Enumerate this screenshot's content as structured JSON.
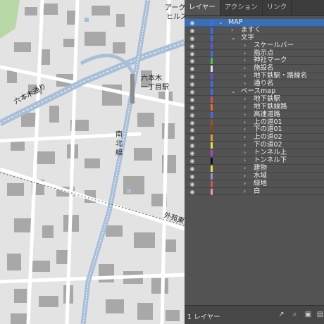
{
  "map": {
    "labels": {
      "roppongi_dori": "六本木通り",
      "roppongi_1chome": "六本木",
      "roppongi_1chome_line2": "一丁目駅",
      "nanboku_1": "南",
      "nanboku_2": "北",
      "nanboku_3": "線",
      "gaien": "外苑東",
      "ark_1": "アーク",
      "ark_2": "ヒルズ"
    }
  },
  "panel": {
    "tabs": [
      {
        "label": "レイヤー"
      },
      {
        "label": "アクション"
      },
      {
        "label": "リンク"
      }
    ],
    "layers": [
      {
        "label": "MAP",
        "color": "#3b6ff0"
      },
      {
        "label": "ますく",
        "color": "#3b6ff0"
      },
      {
        "label": "文字",
        "color": "#3b6ff0"
      },
      {
        "label": "スケールバー",
        "color": "#6b4fd8"
      },
      {
        "label": "指示点",
        "color": "#3b6ff0"
      },
      {
        "label": "神社マーク",
        "color": "#4fc24f"
      },
      {
        "label": "施設名",
        "color": "#e0e0e0"
      },
      {
        "label": "地下鉄駅・路線名",
        "color": "#6b4fd8"
      },
      {
        "label": "通り名",
        "color": "#3b6ff0"
      },
      {
        "label": "ベースmap",
        "color": "#3b6ff0"
      },
      {
        "label": "地下鉄駅",
        "color": "#d85050"
      },
      {
        "label": "地下鉄線路",
        "color": "#e07030"
      },
      {
        "label": "高速道路",
        "color": "#3b6ff0"
      },
      {
        "label": "上の道01",
        "color": "#a05030"
      },
      {
        "label": "下の道01",
        "color": "#8b4520"
      },
      {
        "label": "上の道02",
        "color": "#d8a030"
      },
      {
        "label": "下の道02",
        "color": "#e8e040"
      },
      {
        "label": "トンネル上",
        "color": "#b040d8"
      },
      {
        "label": "トンネル下",
        "color": "#111111"
      },
      {
        "label": "建物",
        "color": "#e8e040"
      },
      {
        "label": "水域",
        "color": "#9090e0"
      },
      {
        "label": "緑地",
        "color": "#d85050"
      },
      {
        "label": "白",
        "color": "#e8a0b0"
      }
    ],
    "footer": {
      "count": "1 レイヤー"
    }
  }
}
